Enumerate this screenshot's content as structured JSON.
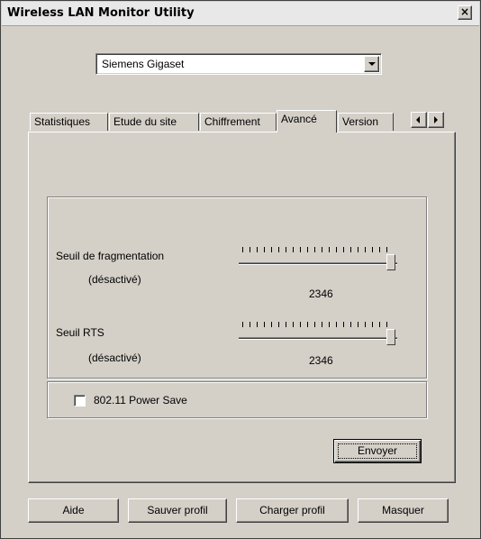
{
  "window": {
    "title": "Wireless LAN Monitor Utility",
    "close_glyph": "×"
  },
  "device_select": {
    "value": "Siemens Gigaset"
  },
  "tabs": [
    {
      "label": "Statistiques",
      "active": false
    },
    {
      "label": "Etude du site",
      "active": false
    },
    {
      "label": "Chiffrement",
      "active": false
    },
    {
      "label": "Avancé",
      "active": true
    },
    {
      "label": "Version",
      "active": false
    }
  ],
  "advanced": {
    "fragmentation": {
      "label": "Seuil de fragmentation",
      "status": "(désactivé)",
      "value": "2346",
      "level": 1.0
    },
    "rts": {
      "label": "Seuil RTS",
      "status": "(désactivé)",
      "value": "2346",
      "level": 1.0
    },
    "power_save": {
      "label": "802.11 Power Save",
      "checked": false
    },
    "send_button": "Envoyer"
  },
  "bottom_buttons": {
    "help": "Aide",
    "save_profile": "Sauver profil",
    "load_profile": "Charger profil",
    "hide": "Masquer"
  },
  "colors": {
    "face": "#d4d0c8",
    "shadow": "#808080",
    "dark_shadow": "#404040",
    "highlight": "#ffffff"
  }
}
